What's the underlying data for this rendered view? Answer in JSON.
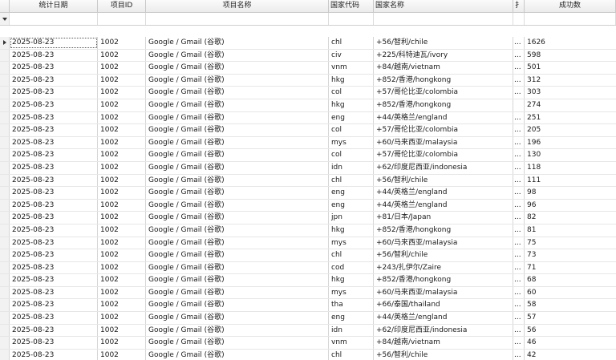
{
  "columns": {
    "date": "统计日期",
    "project_id": "项目ID",
    "project_name": "项目名称",
    "country_code": "国家代码",
    "country_name": "国家名称",
    "extra": "扌",
    "count": "成功数"
  },
  "rows": [
    {
      "date": "2025-08-23",
      "id": "1002",
      "name": "Google / Gmail (谷歌)",
      "code": "chl",
      "country": "+56/智利/chile",
      "extra": "...",
      "count": "1626"
    },
    {
      "date": "2025-08-23",
      "id": "1002",
      "name": "Google / Gmail (谷歌)",
      "code": "civ",
      "country": "+225/科特迪瓦/ivory",
      "extra": "...",
      "count": "598"
    },
    {
      "date": "2025-08-23",
      "id": "1002",
      "name": "Google / Gmail (谷歌)",
      "code": "vnm",
      "country": "+84/越南/vietnam",
      "extra": "...",
      "count": "501"
    },
    {
      "date": "2025-08-23",
      "id": "1002",
      "name": "Google / Gmail (谷歌)",
      "code": "hkg",
      "country": "+852/香港/hongkong",
      "extra": "...",
      "count": "312"
    },
    {
      "date": "2025-08-23",
      "id": "1002",
      "name": "Google / Gmail (谷歌)",
      "code": "col",
      "country": "+57/哥伦比亚/colombia",
      "extra": "...",
      "count": "303"
    },
    {
      "date": "2025-08-23",
      "id": "1002",
      "name": "Google / Gmail (谷歌)",
      "code": "hkg",
      "country": "+852/香港/hongkong",
      "extra": "",
      "count": "274"
    },
    {
      "date": "2025-08-23",
      "id": "1002",
      "name": "Google / Gmail (谷歌)",
      "code": "eng",
      "country": "+44/英格兰/england",
      "extra": "...",
      "count": "251"
    },
    {
      "date": "2025-08-23",
      "id": "1002",
      "name": "Google / Gmail (谷歌)",
      "code": "col",
      "country": "+57/哥伦比亚/colombia",
      "extra": "...",
      "count": "205"
    },
    {
      "date": "2025-08-23",
      "id": "1002",
      "name": "Google / Gmail (谷歌)",
      "code": "mys",
      "country": "+60/马来西亚/malaysia",
      "extra": "...",
      "count": "196"
    },
    {
      "date": "2025-08-23",
      "id": "1002",
      "name": "Google / Gmail (谷歌)",
      "code": "col",
      "country": "+57/哥伦比亚/colombia",
      "extra": "...",
      "count": "130"
    },
    {
      "date": "2025-08-23",
      "id": "1002",
      "name": "Google / Gmail (谷歌)",
      "code": "idn",
      "country": "+62/印度尼西亚/indonesia",
      "extra": "...",
      "count": "118"
    },
    {
      "date": "2025-08-23",
      "id": "1002",
      "name": "Google / Gmail (谷歌)",
      "code": "chl",
      "country": "+56/智利/chile",
      "extra": "...",
      "count": "111"
    },
    {
      "date": "2025-08-23",
      "id": "1002",
      "name": "Google / Gmail (谷歌)",
      "code": "eng",
      "country": "+44/英格兰/england",
      "extra": "...",
      "count": "98"
    },
    {
      "date": "2025-08-23",
      "id": "1002",
      "name": "Google / Gmail (谷歌)",
      "code": "eng",
      "country": "+44/英格兰/england",
      "extra": "...",
      "count": "96"
    },
    {
      "date": "2025-08-23",
      "id": "1002",
      "name": "Google / Gmail (谷歌)",
      "code": "jpn",
      "country": "+81/日本/Japan",
      "extra": "...",
      "count": "82"
    },
    {
      "date": "2025-08-23",
      "id": "1002",
      "name": "Google / Gmail (谷歌)",
      "code": "hkg",
      "country": "+852/香港/hongkong",
      "extra": "...",
      "count": "81"
    },
    {
      "date": "2025-08-23",
      "id": "1002",
      "name": "Google / Gmail (谷歌)",
      "code": "mys",
      "country": "+60/马来西亚/malaysia",
      "extra": "...",
      "count": "75"
    },
    {
      "date": "2025-08-23",
      "id": "1002",
      "name": "Google / Gmail (谷歌)",
      "code": "chl",
      "country": "+56/智利/chile",
      "extra": "...",
      "count": "73"
    },
    {
      "date": "2025-08-23",
      "id": "1002",
      "name": "Google / Gmail (谷歌)",
      "code": "cod",
      "country": "+243/扎伊尔/Zaire",
      "extra": "...",
      "count": "71"
    },
    {
      "date": "2025-08-23",
      "id": "1002",
      "name": "Google / Gmail (谷歌)",
      "code": "hkg",
      "country": "+852/香港/hongkong",
      "extra": "...",
      "count": "68"
    },
    {
      "date": "2025-08-23",
      "id": "1002",
      "name": "Google / Gmail (谷歌)",
      "code": "mys",
      "country": "+60/马来西亚/malaysia",
      "extra": "...",
      "count": "60"
    },
    {
      "date": "2025-08-23",
      "id": "1002",
      "name": "Google / Gmail (谷歌)",
      "code": "tha",
      "country": "+66/泰国/thailand",
      "extra": "...",
      "count": "58"
    },
    {
      "date": "2025-08-23",
      "id": "1002",
      "name": "Google / Gmail (谷歌)",
      "code": "eng",
      "country": "+44/英格兰/england",
      "extra": "...",
      "count": "57"
    },
    {
      "date": "2025-08-23",
      "id": "1002",
      "name": "Google / Gmail (谷歌)",
      "code": "idn",
      "country": "+62/印度尼西亚/indonesia",
      "extra": "...",
      "count": "56"
    },
    {
      "date": "2025-08-23",
      "id": "1002",
      "name": "Google / Gmail (谷歌)",
      "code": "vnm",
      "country": "+84/越南/vietnam",
      "extra": "...",
      "count": "46"
    },
    {
      "date": "2025-08-23",
      "id": "1002",
      "name": "Google / Gmail (谷歌)",
      "code": "chl",
      "country": "+56/智利/chile",
      "extra": "...",
      "count": "42"
    }
  ]
}
